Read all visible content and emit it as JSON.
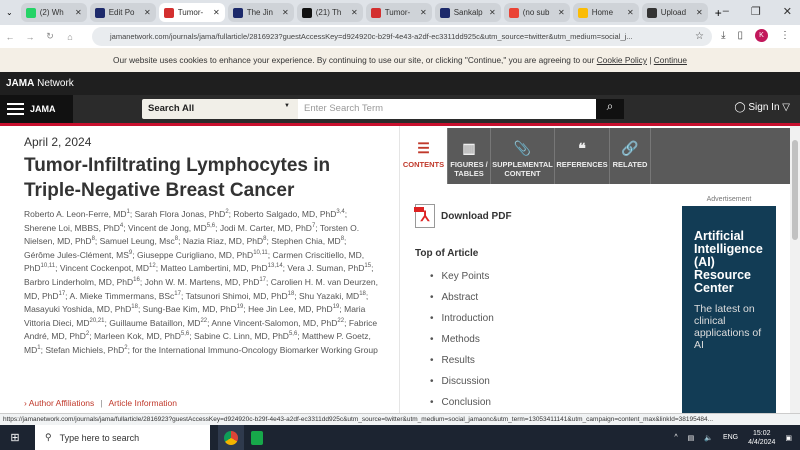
{
  "browser": {
    "tabs": [
      {
        "title": "(2) Wh",
        "color": "#25d366"
      },
      {
        "title": "Edit Po",
        "color": "#1d2a6b"
      },
      {
        "title": "Tumor-",
        "color": "#d32f2f",
        "active": true
      },
      {
        "title": "The Jin",
        "color": "#1d2a6b"
      },
      {
        "title": "(21) Th",
        "color": "#111111"
      },
      {
        "title": "Tumor-",
        "color": "#d32f2f"
      },
      {
        "title": "Sankalp",
        "color": "#1d2a6b"
      },
      {
        "title": "(no sub",
        "color": "#ea4335"
      },
      {
        "title": "Home",
        "color": "#fbbc05"
      },
      {
        "title": "Upload",
        "color": "#333333"
      }
    ],
    "url": "jamanetwork.com/journals/jama/fullarticle/2816923?guestAccessKey=d924920c-b29f-4e43-a2df-ec3311dd925c&utm_source=twitter&utm_medium=social_j...",
    "profile_initial": "K",
    "status_url": "https://jamanetwork.com/journals/jama/fullarticle/2816923?guestAccessKey=d924920c-b29f-4e43-a2df-ec3311dd925c&utm_source=twitter&utm_medium=social_jamaonc&utm_term=13053411141&utm_campaign=content_max&linkId=38195484..."
  },
  "cookie": {
    "text": "Our website uses cookies to enhance your experience. By continuing to use our site, or clicking \"Continue,\" you are agreeing to our",
    "policy": "Cookie Policy",
    "sep": "|",
    "continue": "Continue"
  },
  "header": {
    "network_bold": "JAMA",
    "network_rest": " Network",
    "journal": "JAMA",
    "search_scope": "Search All",
    "search_placeholder": "Enter Search Term",
    "sign_in": "Sign In"
  },
  "article": {
    "date": "April 2, 2024",
    "title": "Tumor-Infiltrating Lymphocytes in Triple-Negative Breast Cancer",
    "authors": [
      {
        "n": "Roberto A. Leon-Ferre, MD",
        "s": "1"
      },
      {
        "n": "Sarah Flora Jonas, PhD",
        "s": "2"
      },
      {
        "n": "Roberto Salgado, MD, PhD",
        "s": "3,4"
      },
      {
        "n": "Sherene Loi, MBBS, PhD",
        "s": "4"
      },
      {
        "n": "Vincent de Jong, MD",
        "s": "5,6"
      },
      {
        "n": "Jodi M. Carter, MD, PhD",
        "s": "7"
      },
      {
        "n": "Torsten O. Nielsen, MD, PhD",
        "s": "8"
      },
      {
        "n": "Samuel Leung, Msc",
        "s": "8"
      },
      {
        "n": "Nazia Riaz, MD, PhD",
        "s": "8"
      },
      {
        "n": "Stephen Chia, MD",
        "s": "8"
      },
      {
        "n": "Gérôme Jules-Clément, MS",
        "s": "9"
      },
      {
        "n": "Giuseppe Curigliano, MD, PhD",
        "s": "10,11"
      },
      {
        "n": "Carmen Criscitiello, MD, PhD",
        "s": "10,11"
      },
      {
        "n": "Vincent Cockenpot, MD",
        "s": "12"
      },
      {
        "n": "Matteo Lambertini, MD, PhD",
        "s": "13,14"
      },
      {
        "n": "Vera J. Suman, PhD",
        "s": "15"
      },
      {
        "n": "Barbro Linderholm, MD, PhD",
        "s": "16"
      },
      {
        "n": "John W. M. Martens, MD, PhD",
        "s": "17"
      },
      {
        "n": "Carolien H. M. van Deurzen, MD, PhD",
        "s": "17"
      },
      {
        "n": "A. Mieke Timmermans, BSc",
        "s": "17"
      },
      {
        "n": "Tatsunori Shimoi, MD, PhD",
        "s": "18"
      },
      {
        "n": "Shu Yazaki, MD",
        "s": "18"
      },
      {
        "n": "Masayuki Yoshida, MD, PhD",
        "s": "18"
      },
      {
        "n": "Sung-Bae Kim, MD, PhD",
        "s": "19"
      },
      {
        "n": "Hee Jin Lee, MD, PhD",
        "s": "19"
      },
      {
        "n": "Maria Vittoria Dieci, MD",
        "s": "20,21"
      },
      {
        "n": "Guillaume Bataillon, MD",
        "s": "22"
      },
      {
        "n": "Anne Vincent-Salomon, MD, PhD",
        "s": "22"
      },
      {
        "n": "Fabrice André, MD, PhD",
        "s": "2"
      },
      {
        "n": "Marleen Kok, MD, PhD",
        "s": "5,6"
      },
      {
        "n": "Sabine C. Linn, MD, PhD",
        "s": "5,6"
      },
      {
        "n": "Matthew P. Goetz, MD",
        "s": "1"
      },
      {
        "n": "Stefan Michiels, PhD",
        "s": "2"
      }
    ],
    "group": "for the International Immuno-Oncology Biomarker Working Group",
    "affiliations": "Author Affiliations",
    "article_info": "Article Information"
  },
  "panel": {
    "tabs": [
      {
        "label": "CONTENTS",
        "icon": "list-icon"
      },
      {
        "label": "FIGURES / TABLES",
        "icon": "chart-icon"
      },
      {
        "label": "SUPPLEMENTAL CONTENT",
        "icon": "paperclip-icon"
      },
      {
        "label": "REFERENCES",
        "icon": "quote-icon"
      },
      {
        "label": "RELATED",
        "icon": "link-icon"
      }
    ],
    "download_pdf": "Download PDF",
    "toc_heading": "Top of Article",
    "toc": [
      "Key Points",
      "Abstract",
      "Introduction",
      "Methods",
      "Results",
      "Discussion",
      "Conclusion"
    ],
    "ad_label": "Advertisement",
    "ad_title": "Artificial Intelligence (AI) Resource Center",
    "ad_sub": "The latest on clinical applications of AI"
  },
  "taskbar": {
    "search_placeholder": "Type here to search",
    "lang": "ENG",
    "time": "15:02",
    "date": "4/4/2024"
  }
}
